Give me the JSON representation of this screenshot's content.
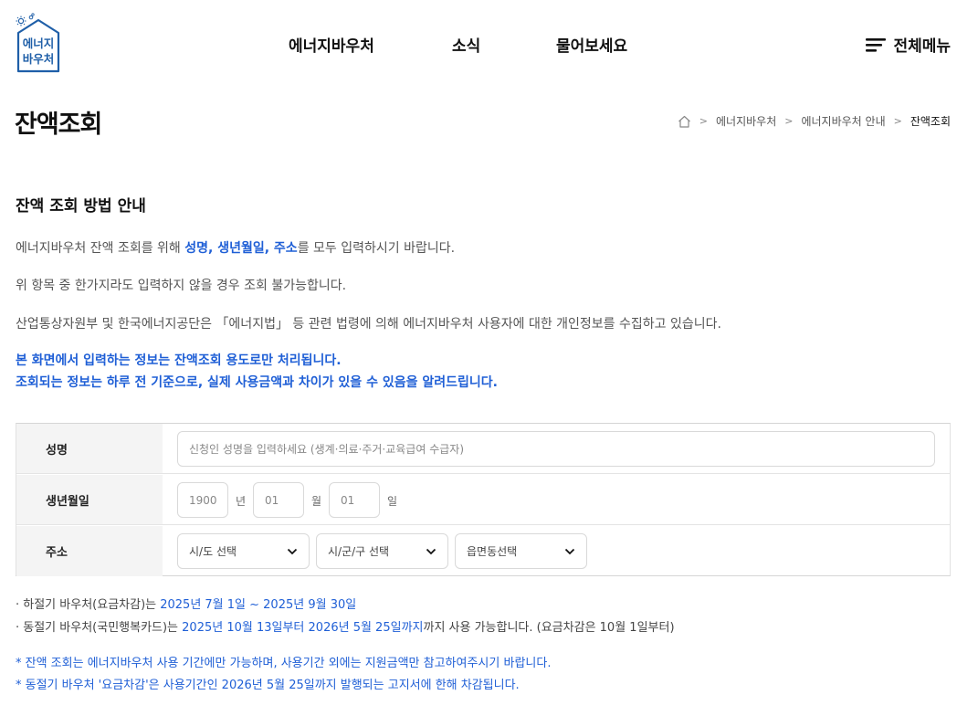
{
  "logo": {
    "line1": "에너지",
    "line2": "바우처"
  },
  "nav": {
    "items": [
      "에너지바우처",
      "소식",
      "물어보세요"
    ],
    "menu_label": "전체메뉴"
  },
  "page": {
    "title": "잔액조회"
  },
  "breadcrumb": {
    "items": [
      "에너지바우처",
      "에너지바우처 안내",
      "잔액조회"
    ]
  },
  "guide": {
    "title": "잔액 조회 방법 안내",
    "p1": {
      "pre": "에너지바우처 잔액 조회를 위해 ",
      "highlight": "성명, 생년월일, 주소",
      "post": "를 모두 입력하시기 바랍니다."
    },
    "p2": "위 항목 중 한가지라도 입력하지 않을 경우 조회 불가능합니다.",
    "p3": "산업통상자원부 및 한국에너지공단은 「에너지법」 등 관련 법령에 의해 에너지바우처 사용자에 대한 개인정보를 수집하고 있습니다.",
    "n1": "본 화면에서 입력하는 정보는 잔액조회 용도로만 처리됩니다.",
    "n2": "조회되는 정보는 하루 전 기준으로, 실제 사용금액과 차이가 있을 수 있음을 알려드립니다."
  },
  "form": {
    "name": {
      "label": "성명",
      "placeholder": "신청인 성명을 입력하세요 (생계·의료·주거·교육급여 수급자)"
    },
    "birth": {
      "label": "생년월일",
      "year_placeholder": "1900",
      "year_unit": "년",
      "month_placeholder": "01",
      "month_unit": "월",
      "day_placeholder": "01",
      "day_unit": "일"
    },
    "address": {
      "label": "주소",
      "sido": "시/도 선택",
      "sigungu": "시/군/구 선택",
      "eupmyeondong": "읍면동선택"
    }
  },
  "period": {
    "summer": {
      "pre": "· 하절기 바우처(요금차감)는 ",
      "dates": "2025년 7월 1일 ~ 2025년 9월 30일"
    },
    "winter": {
      "pre": "· 동절기 바우처(국민행복카드)는 ",
      "dates": "2025년 10월 13일부터 2026년 5월 25일까지",
      "post": "까지 사용 가능합니다. (요금차감은 10월 1일부터)"
    }
  },
  "notes": {
    "n1": "* 잔액 조회는 에너지바우처 사용 기간에만 가능하며, 사용기간 외에는 지원금액만 참고하여주시기 바랍니다.",
    "n2": "* 동절기 바우처 '요금차감'은 사용기간인 2026년 5월 25일까지 발행되는 고지서에 한해 차감됩니다."
  },
  "colors": {
    "accent": "#1f5fd6",
    "logo_blue": "#1f5fa8"
  },
  "icons": [
    "house-sun-logo-icon",
    "hamburger-icon",
    "home-icon",
    "chevron-right-icon",
    "chevron-down-icon"
  ]
}
